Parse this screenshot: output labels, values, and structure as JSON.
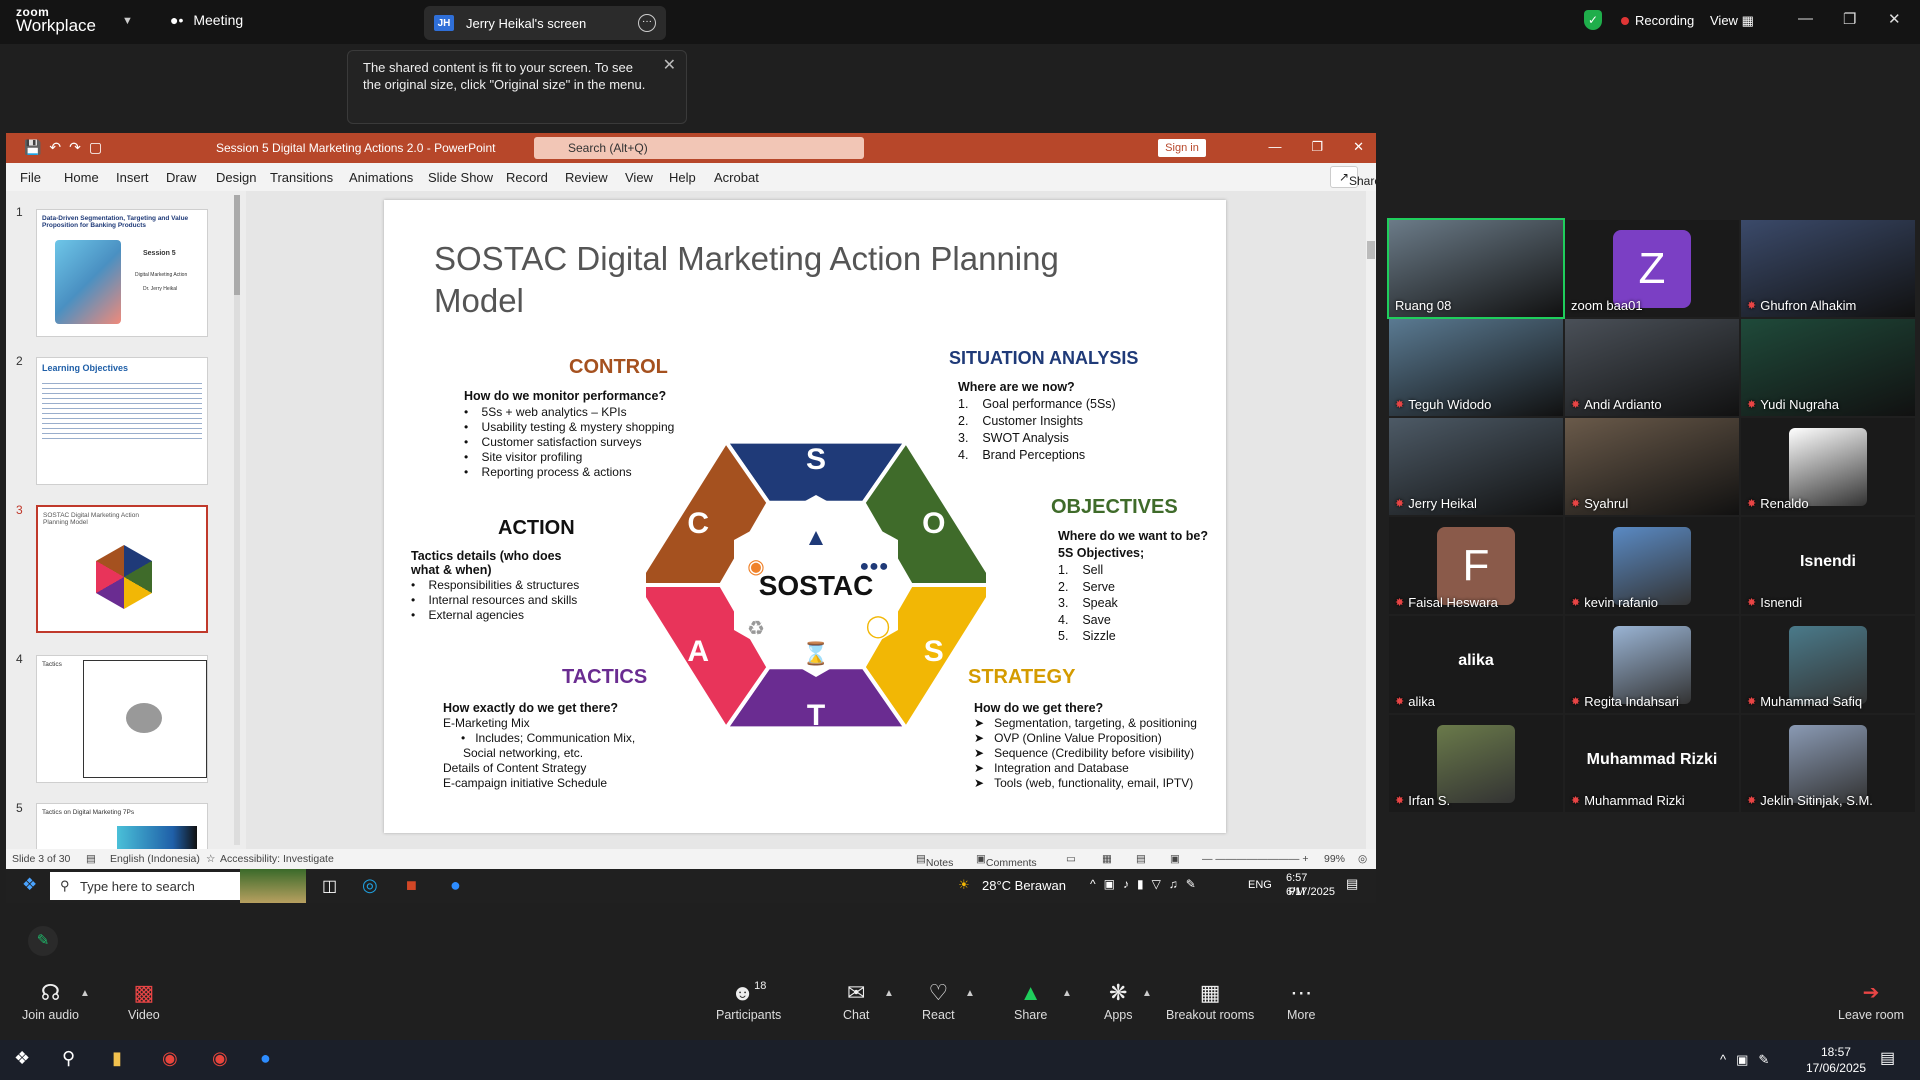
{
  "zoom_top": {
    "logo_line1": "zoom",
    "logo_line2": "Workplace",
    "meeting_label": "Meeting",
    "screen_tab_initials": "JH",
    "screen_tab_label": "Jerry Heikal's screen",
    "recording_label": "Recording",
    "view_label": "View"
  },
  "tooltip": {
    "text": "The shared content is fit to your screen. To see the original size, click \"Original size\" in the menu."
  },
  "ppt": {
    "window_title": "Session 5 Digital Marketing Actions 2.0  -  PowerPoint",
    "search_placeholder": "Search (Alt+Q)",
    "signin": "Sign in",
    "share": "Share",
    "menu": [
      "File",
      "Home",
      "Insert",
      "Draw",
      "Design",
      "Transitions",
      "Animations",
      "Slide Show",
      "Record",
      "Review",
      "View",
      "Help",
      "Acrobat"
    ],
    "thumbnails": [
      {
        "num": "1",
        "title": "Data-Driven Segmentation, Targeting and Value Proposition for Banking Products",
        "sub": "Session 5",
        "sub2": "Digital Marketing Action",
        "sub3": "Dr. Jerry Heikal"
      },
      {
        "num": "2",
        "title": "Learning Objectives"
      },
      {
        "num": "3",
        "title": "SOSTAC Digital Marketing Action Planning Model"
      },
      {
        "num": "4",
        "title": "Tactics"
      },
      {
        "num": "5",
        "title": "Tactics on Digital Marketing 7Ps"
      }
    ],
    "status": {
      "slide_count": "Slide 3 of 30",
      "language": "English (Indonesia)",
      "accessibility": "Accessibility: Investigate",
      "notes": "Notes",
      "comments": "Comments",
      "zoom": "99%"
    },
    "taskbar": {
      "search_placeholder": "Type here to search",
      "weather": "28°C  Berawan",
      "lang": "ENG",
      "time": "6:57 PM",
      "date": "6/17/2025"
    }
  },
  "slide": {
    "title": "SOSTAC Digital Marketing Action Planning Model",
    "control": {
      "head": "CONTROL",
      "sub": "How do we monitor performance?",
      "items": [
        "5Ss + web analytics – KPIs",
        "Usability testing & mystery shopping",
        "Customer satisfaction surveys",
        "Site visitor profiling",
        "Reporting process & actions"
      ]
    },
    "situation": {
      "head": "SITUATION ANALYSIS",
      "sub": "Where are we now?",
      "items": [
        "Goal performance (5Ss)",
        "Customer Insights",
        "SWOT Analysis",
        "Brand Perceptions"
      ]
    },
    "action": {
      "head": "ACTION",
      "sub": "Tactics details (who does what & when)",
      "items": [
        "Responsibilities & structures",
        "Internal resources and skills",
        "External agencies"
      ]
    },
    "objectives": {
      "head": "OBJECTIVES",
      "sub": "Where do we want to be?",
      "sub2": "5S Objectives;",
      "items": [
        "Sell",
        "Serve",
        "Speak",
        "Save",
        "Sizzle"
      ]
    },
    "tactics": {
      "head": "TACTICS",
      "sub": "How exactly do we get there?",
      "line1": "E-Marketing Mix",
      "line2": "Includes;      Communication      Mix,",
      "line3": "Social networking, etc.",
      "line4": "Details of Content Strategy",
      "line5": "E-campaign initiative Schedule"
    },
    "strategy": {
      "head": "STRATEGY",
      "sub": "How do we get there?",
      "items": [
        "Segmentation, targeting, & positioning",
        "OVP (Online Value Proposition)",
        "Sequence (Credibility before visibility)",
        "Integration and  Database",
        "Tools (web, functionality, email, IPTV)"
      ]
    },
    "hex_center": "SOSTAC",
    "hex_letters": [
      "S",
      "O",
      "S",
      "T",
      "A",
      "C"
    ],
    "hex_colors": [
      "#1f3a78",
      "#3f6b2a",
      "#f2b705",
      "#6a2c91",
      "#e8345a",
      "#a5511f"
    ]
  },
  "participants": [
    {
      "name": "Ruang 08",
      "muted": false,
      "kind": "photo",
      "color": "#6b7b88"
    },
    {
      "name": "zoom baa01",
      "muted": false,
      "kind": "avatar",
      "letter": "Z",
      "color": "#7b3fc4"
    },
    {
      "name": "Ghufron Alhakim",
      "muted": true,
      "kind": "photo",
      "color": "#3b4a6a"
    },
    {
      "name": "Teguh Widodo",
      "muted": true,
      "kind": "photo",
      "color": "#5a7a92"
    },
    {
      "name": "Andi Ardianto",
      "muted": true,
      "kind": "photo",
      "color": "#4a5058"
    },
    {
      "name": "Yudi Nugraha",
      "muted": true,
      "kind": "photo",
      "color": "#1f4a3a"
    },
    {
      "name": "Jerry Heikal",
      "muted": true,
      "kind": "photo",
      "color": "#4d5a66"
    },
    {
      "name": "Syahrul",
      "muted": true,
      "kind": "photo",
      "color": "#6a5a4a"
    },
    {
      "name": "Renaldo",
      "muted": true,
      "kind": "avatar-img",
      "color": "#ffffff"
    },
    {
      "name": "Faisal Heswara",
      "muted": true,
      "kind": "avatar",
      "letter": "F",
      "color": "#8a5a4a"
    },
    {
      "name": "kevin rafanio",
      "muted": true,
      "kind": "avatar-img",
      "color": "#5a8ac4"
    },
    {
      "name": "Isnendi",
      "muted": true,
      "kind": "text",
      "display": "Isnendi"
    },
    {
      "name": "alika",
      "muted": true,
      "kind": "text",
      "display": "alika"
    },
    {
      "name": "Regita Indahsari",
      "muted": true,
      "kind": "avatar-img",
      "color": "#9ab4d4"
    },
    {
      "name": "Muhammad Safiq",
      "muted": true,
      "kind": "avatar-img",
      "color": "#4a7a8a"
    },
    {
      "name": "Irfan S.",
      "muted": true,
      "kind": "avatar-img",
      "color": "#6a7a4a"
    },
    {
      "name": "Muhammad Rizki",
      "muted": true,
      "kind": "text",
      "display": "Muhammad Rizki"
    },
    {
      "name": "Jeklin Sitinjak, S.M.",
      "muted": true,
      "kind": "avatar-img",
      "color": "#8a9ab4"
    }
  ],
  "zoom_toolbar": {
    "join_audio": "Join audio",
    "video": "Video",
    "participants": "Participants",
    "participants_count": "18",
    "chat": "Chat",
    "react": "React",
    "share": "Share",
    "apps": "Apps",
    "breakout": "Breakout rooms",
    "more": "More",
    "leave": "Leave room"
  },
  "os": {
    "time": "18:57",
    "date": "17/06/2025"
  }
}
